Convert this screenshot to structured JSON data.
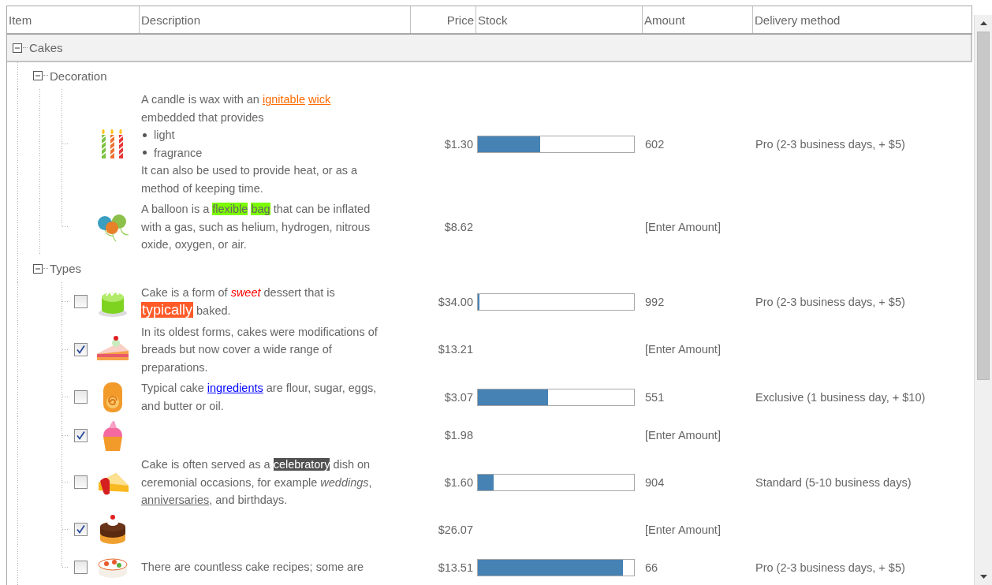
{
  "columns": [
    "Item",
    "Description",
    "Price",
    "Stock",
    "Amount",
    "Delivery method"
  ],
  "groups": [
    {
      "label": "Cakes",
      "expanded": true,
      "children": [
        {
          "label": "Decoration",
          "expanded": true,
          "items": [
            {
              "description": [
                {
                  "kind": "paragraph",
                  "segments": [
                    {
                      "text": "A candle is wax with an "
                    },
                    {
                      "text": "ignitable",
                      "kind": "link",
                      "color": "#ff6a00"
                    },
                    {
                      "text": "wick",
                      "kind": "link",
                      "color": "#ff6a00",
                      "gap_before": true
                    },
                    {
                      "text": " embedded that provides"
                    }
                  ]
                },
                {
                  "kind": "bullets",
                  "items": [
                    "light",
                    "fragrance"
                  ]
                },
                {
                  "kind": "paragraph",
                  "segments": [
                    {
                      "text": "It can also be used to provide heat, or as a method of keeping time."
                    }
                  ]
                }
              ],
              "price": "$1.30",
              "stock": {
                "level": 0.4
              },
              "amount": "602",
              "delivery": "Pro (2-3 business days, + $5)"
            },
            {
              "description": [
                {
                  "kind": "paragraph",
                  "segments": [
                    {
                      "text": "A balloon is a "
                    },
                    {
                      "text": "flexible",
                      "kind": "highlight",
                      "color": "#7cfc00"
                    },
                    {
                      "text": "bag",
                      "kind": "highlight",
                      "color": "#7cfc00",
                      "gap_before": true
                    },
                    {
                      "text": " that can be inflated with a gas, such as helium, hydrogen, nitrous oxide, oxygen, or air."
                    }
                  ]
                }
              ],
              "price": "$8.62",
              "amount": "[Enter Amount]"
            }
          ]
        },
        {
          "label": "Types",
          "expanded": true,
          "items": [
            {
              "checked": false,
              "description": [
                {
                  "kind": "paragraph",
                  "segments": [
                    {
                      "text": "Cake is a form of "
                    },
                    {
                      "text": "sweet",
                      "kind": "emphasis",
                      "color": "#ff0000"
                    },
                    {
                      "text": " dessert that is "
                    },
                    {
                      "text": "typically",
                      "kind": "callout",
                      "color": "#ff5a28"
                    },
                    {
                      "text": " baked."
                    }
                  ]
                }
              ],
              "price": "$34.00",
              "stock": {
                "level": 0.01
              },
              "amount": "992",
              "delivery": "Pro (2-3 business days, + $5)"
            },
            {
              "checked": true,
              "description": [
                {
                  "kind": "paragraph",
                  "segments": [
                    {
                      "text": "In its oldest forms, cakes were modifications of breads but now cover a wide range of preparations."
                    }
                  ]
                }
              ],
              "price": "$13.21",
              "amount": "[Enter Amount]"
            },
            {
              "checked": false,
              "description": [
                {
                  "kind": "paragraph",
                  "segments": [
                    {
                      "text": "Typical cake "
                    },
                    {
                      "text": "ingredients",
                      "kind": "link",
                      "color": "#0000ff"
                    },
                    {
                      "text": " are flour, sugar, eggs, and butter or oil."
                    }
                  ]
                }
              ],
              "price": "$3.07",
              "stock": {
                "level": 0.45
              },
              "amount": "551",
              "delivery": "Exclusive (1 business day, + $10)"
            },
            {
              "checked": true,
              "price": "$1.98",
              "amount": "[Enter Amount]"
            },
            {
              "checked": false,
              "description": [
                {
                  "kind": "paragraph",
                  "segments": [
                    {
                      "text": "Cake is often served as a "
                    },
                    {
                      "text": "celebratory",
                      "kind": "inverse",
                      "color": "#505050"
                    },
                    {
                      "text": " dish on ceremonial occasions, for example "
                    },
                    {
                      "text": "weddings",
                      "kind": "italic"
                    },
                    {
                      "text": ", "
                    },
                    {
                      "text": "anniversaries",
                      "kind": "link"
                    },
                    {
                      "text": ", and birthdays."
                    }
                  ]
                }
              ],
              "price": "$1.60",
              "stock": {
                "level": 0.1
              },
              "amount": "904",
              "delivery": "Standard (5-10 business days)"
            },
            {
              "checked": true,
              "price": "$26.07",
              "amount": "[Enter Amount]"
            },
            {
              "checked": false,
              "description": [
                {
                  "kind": "paragraph",
                  "segments": [
                    {
                      "text": "There are countless cake recipes; some are"
                    }
                  ]
                }
              ],
              "price": "$13.51",
              "stock": {
                "level": 0.93
              },
              "amount": "66",
              "delivery": "Pro (2-3 business days, + $5)"
            }
          ]
        }
      ]
    }
  ]
}
